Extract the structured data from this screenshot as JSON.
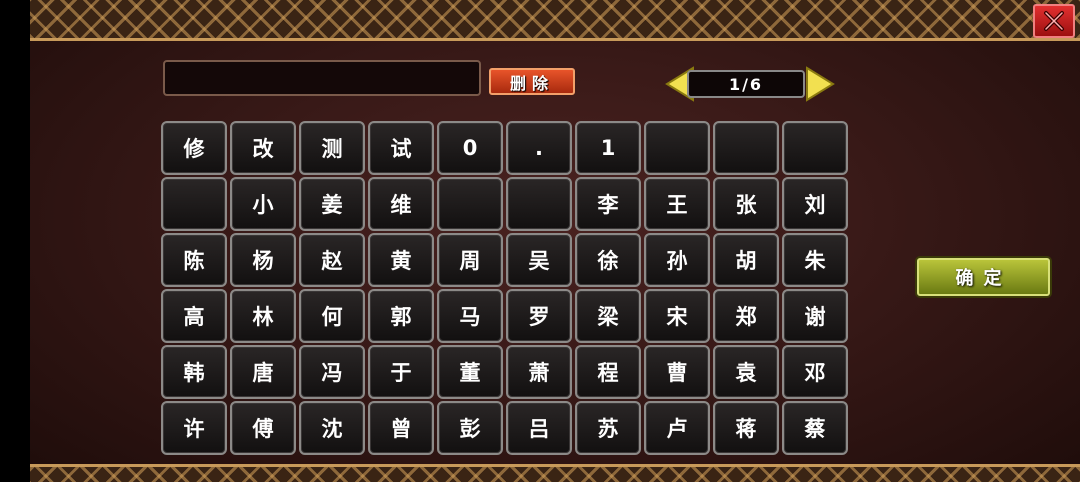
{
  "input": {
    "value": ""
  },
  "buttons": {
    "delete_label": "删除",
    "confirm_label": "确定"
  },
  "pager": {
    "page_text": "1/6"
  },
  "keys": [
    "修",
    "改",
    "测",
    "试",
    "0",
    ".",
    "1",
    "",
    "",
    "",
    "",
    "小",
    "姜",
    "维",
    "",
    "",
    "李",
    "王",
    "张",
    "刘",
    "陈",
    "杨",
    "赵",
    "黄",
    "周",
    "吴",
    "徐",
    "孙",
    "胡",
    "朱",
    "高",
    "林",
    "何",
    "郭",
    "马",
    "罗",
    "梁",
    "宋",
    "郑",
    "谢",
    "韩",
    "唐",
    "冯",
    "于",
    "董",
    "萧",
    "程",
    "曹",
    "袁",
    "邓",
    "许",
    "傅",
    "沈",
    "曾",
    "彭",
    "吕",
    "苏",
    "卢",
    "蒋",
    "蔡"
  ],
  "colors": {
    "confirm": "#8a9a1e",
    "delete": "#d0461c",
    "close": "#c41e1e",
    "pager_arrow": "#f2e050"
  },
  "icons": {
    "close": "close-icon",
    "prev": "arrow-left-icon",
    "next": "arrow-right-icon"
  }
}
